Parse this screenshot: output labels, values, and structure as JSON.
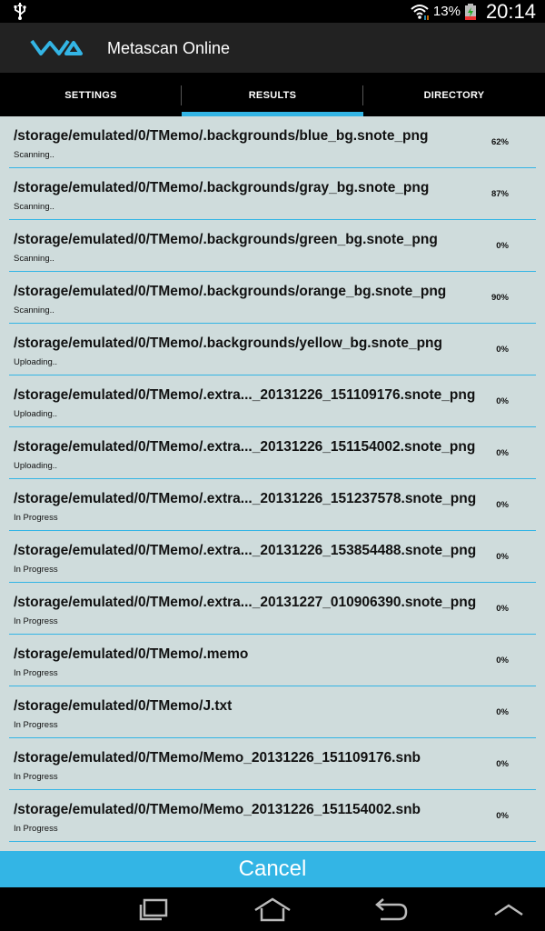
{
  "status_bar": {
    "battery_text": "13%",
    "time": "20:14"
  },
  "app": {
    "title": "Metascan Online",
    "accent_color": "#33b5e5"
  },
  "tabs": [
    {
      "label": "SETTINGS",
      "active": false
    },
    {
      "label": "RESULTS",
      "active": true
    },
    {
      "label": "DIRECTORY",
      "active": false
    }
  ],
  "results": [
    {
      "path": "/storage/emulated/0/TMemo/.backgrounds/blue_bg.snote_png",
      "status": "Scanning..",
      "percent": "62%"
    },
    {
      "path": "/storage/emulated/0/TMemo/.backgrounds/gray_bg.snote_png",
      "status": "Scanning..",
      "percent": "87%"
    },
    {
      "path": "/storage/emulated/0/TMemo/.backgrounds/green_bg.snote_png",
      "status": "Scanning..",
      "percent": "0%"
    },
    {
      "path": "/storage/emulated/0/TMemo/.backgrounds/orange_bg.snote_png",
      "status": "Scanning..",
      "percent": "90%"
    },
    {
      "path": "/storage/emulated/0/TMemo/.backgrounds/yellow_bg.snote_png",
      "status": "Uploading..",
      "percent": "0%"
    },
    {
      "path": "/storage/emulated/0/TMemo/.extra..._20131226_151109176.snote_png",
      "status": "Uploading..",
      "percent": "0%"
    },
    {
      "path": "/storage/emulated/0/TMemo/.extra..._20131226_151154002.snote_png",
      "status": "Uploading..",
      "percent": "0%"
    },
    {
      "path": "/storage/emulated/0/TMemo/.extra..._20131226_151237578.snote_png",
      "status": "In Progress",
      "percent": "0%"
    },
    {
      "path": "/storage/emulated/0/TMemo/.extra..._20131226_153854488.snote_png",
      "status": "In Progress",
      "percent": "0%"
    },
    {
      "path": "/storage/emulated/0/TMemo/.extra..._20131227_010906390.snote_png",
      "status": "In Progress",
      "percent": "0%"
    },
    {
      "path": "/storage/emulated/0/TMemo/.memo",
      "status": "In Progress",
      "percent": "0%"
    },
    {
      "path": "/storage/emulated/0/TMemo/J.txt",
      "status": "In Progress",
      "percent": "0%"
    },
    {
      "path": "/storage/emulated/0/TMemo/Memo_20131226_151109176.snb",
      "status": "In Progress",
      "percent": "0%"
    },
    {
      "path": "/storage/emulated/0/TMemo/Memo_20131226_151154002.snb",
      "status": "In Progress",
      "percent": "0%"
    }
  ],
  "cancel_label": "Cancel",
  "icons": {
    "status": [
      "usb-icon",
      "wifi-icon",
      "battery-icon"
    ],
    "nav": [
      "recent-apps-icon",
      "home-icon",
      "back-icon",
      "menu-up-icon"
    ]
  }
}
